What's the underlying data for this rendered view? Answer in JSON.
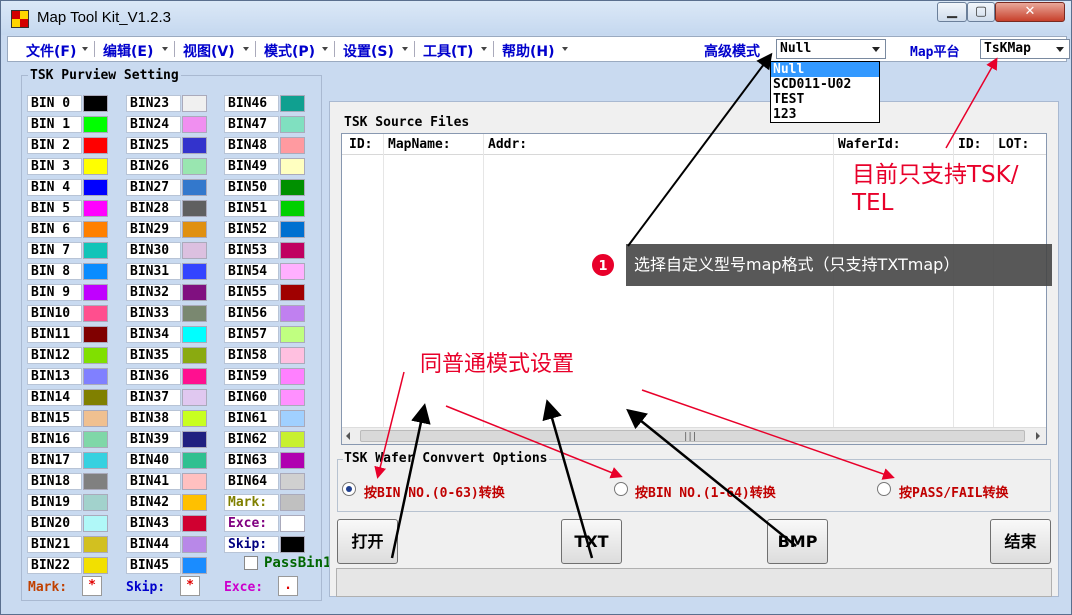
{
  "window": {
    "title": "Map Tool Kit_V1.2.3"
  },
  "menu": [
    {
      "label": "文件(F)"
    },
    {
      "label": "编辑(E)"
    },
    {
      "label": "视图(V)"
    },
    {
      "label": "模式(P)"
    },
    {
      "label": "设置(S)"
    },
    {
      "label": "工具(T)"
    },
    {
      "label": "帮助(H)"
    }
  ],
  "toolbar": {
    "advanced_label": "高级模式",
    "advanced_value": "Null",
    "advanced_options": [
      "Null",
      "SCD011-U02",
      "TEST",
      "123"
    ],
    "map_platform_label": "Map平台",
    "map_platform_value": "TsKMap"
  },
  "left_panel": {
    "title": "TSK Purview Setting",
    "bins": [
      {
        "label": "BIN 0",
        "color": "#000000"
      },
      {
        "label": "BIN 1",
        "color": "#00ff00"
      },
      {
        "label": "BIN 2",
        "color": "#ff0000"
      },
      {
        "label": "BIN 3",
        "color": "#ffff00"
      },
      {
        "label": "BIN 4",
        "color": "#0000ff"
      },
      {
        "label": "BIN 5",
        "color": "#ff00ff"
      },
      {
        "label": "BIN 6",
        "color": "#ff8000"
      },
      {
        "label": "BIN 7",
        "color": "#11c4b8"
      },
      {
        "label": "BIN 8",
        "color": "#0a8cff"
      },
      {
        "label": "BIN 9",
        "color": "#c000ff"
      },
      {
        "label": "BIN10",
        "color": "#ff4f8e"
      },
      {
        "label": "BIN11",
        "color": "#800000"
      },
      {
        "label": "BIN12",
        "color": "#80e000"
      },
      {
        "label": "BIN13",
        "color": "#8080ff"
      },
      {
        "label": "BIN14",
        "color": "#808000"
      },
      {
        "label": "BIN15",
        "color": "#f0c090"
      },
      {
        "label": "BIN16",
        "color": "#7fd7a8"
      },
      {
        "label": "BIN17",
        "color": "#36d1e0"
      },
      {
        "label": "BIN18",
        "color": "#808080"
      },
      {
        "label": "BIN19",
        "color": "#a2d2cc"
      },
      {
        "label": "BIN20",
        "color": "#b0f8f8"
      },
      {
        "label": "BIN21",
        "color": "#d2c020"
      },
      {
        "label": "BIN22",
        "color": "#f2e000"
      },
      {
        "label": "BIN23",
        "color": "#f0f0f0"
      },
      {
        "label": "BIN24",
        "color": "#f08ff0"
      },
      {
        "label": "BIN25",
        "color": "#3333cc"
      },
      {
        "label": "BIN26",
        "color": "#99e6b0"
      },
      {
        "label": "BIN27",
        "color": "#3378cc"
      },
      {
        "label": "BIN28",
        "color": "#606060"
      },
      {
        "label": "BIN29",
        "color": "#e09010"
      },
      {
        "label": "BIN30",
        "color": "#dcc0e0"
      },
      {
        "label": "BIN31",
        "color": "#3344ff"
      },
      {
        "label": "BIN32",
        "color": "#801080"
      },
      {
        "label": "BIN33",
        "color": "#7a8870"
      },
      {
        "label": "BIN34",
        "color": "#00ffff"
      },
      {
        "label": "BIN35",
        "color": "#8aaa10"
      },
      {
        "label": "BIN36",
        "color": "#ff1090"
      },
      {
        "label": "BIN37",
        "color": "#e0c8f0"
      },
      {
        "label": "BIN38",
        "color": "#c8ff20"
      },
      {
        "label": "BIN39",
        "color": "#202080"
      },
      {
        "label": "BIN40",
        "color": "#30c090"
      },
      {
        "label": "BIN41",
        "color": "#ffc0c0"
      },
      {
        "label": "BIN42",
        "color": "#ffc000"
      },
      {
        "label": "BIN43",
        "color": "#d00030"
      },
      {
        "label": "BIN44",
        "color": "#b888e8"
      },
      {
        "label": "BIN45",
        "color": "#1a8cff"
      },
      {
        "label": "BIN46",
        "color": "#10a090"
      },
      {
        "label": "BIN47",
        "color": "#80e0c0"
      },
      {
        "label": "BIN48",
        "color": "#ff9aa0"
      },
      {
        "label": "BIN49",
        "color": "#ffffc0"
      },
      {
        "label": "BIN50",
        "color": "#009000"
      },
      {
        "label": "BIN51",
        "color": "#00d000"
      },
      {
        "label": "BIN52",
        "color": "#0070d0"
      },
      {
        "label": "BIN53",
        "color": "#c00060"
      },
      {
        "label": "BIN54",
        "color": "#ffb0ff"
      },
      {
        "label": "BIN55",
        "color": "#a00000"
      },
      {
        "label": "BIN56",
        "color": "#c080f0"
      },
      {
        "label": "BIN57",
        "color": "#c0ff80"
      },
      {
        "label": "BIN58",
        "color": "#ffc0e0"
      },
      {
        "label": "BIN59",
        "color": "#ff80ff"
      },
      {
        "label": "BIN60",
        "color": "#ff90ff"
      },
      {
        "label": "BIN61",
        "color": "#a0d0ff"
      },
      {
        "label": "BIN62",
        "color": "#c8f030"
      },
      {
        "label": "BIN63",
        "color": "#b000b0"
      },
      {
        "label": "BIN64",
        "color": "#d0d0d0"
      }
    ],
    "specials": [
      {
        "label": "Mark:",
        "color": "#c0c0c0",
        "text_color": "#808000"
      },
      {
        "label": "Exce:",
        "color": "#ffffff",
        "text_color": "#800080"
      },
      {
        "label": "Skip:",
        "color": "#000000",
        "text_color": "#000080"
      }
    ],
    "passbin_label": "PassBin1",
    "bottom": [
      {
        "label": "Mark:",
        "value": "*",
        "color": "#c04000"
      },
      {
        "label": "Skip:",
        "value": "*",
        "color": "#0000cc"
      },
      {
        "label": "Exce:",
        "value": ".",
        "color": "#cc00cc"
      }
    ]
  },
  "source_files": {
    "title": "TSK Source Files",
    "columns": [
      "ID:",
      "MapName:",
      "Addr:",
      "WaferId:",
      "ID:",
      "LOT:"
    ],
    "scroll_grip": "|||"
  },
  "convert": {
    "title": "TSK Wafer Convvert Options",
    "options": [
      {
        "label": "按BIN NO.(0-63)转换",
        "selected": true
      },
      {
        "label": "按BIN NO.(1-64)转换",
        "selected": false
      },
      {
        "label": "按PASS/FAIL转换",
        "selected": false
      }
    ]
  },
  "buttons": {
    "open": "打开",
    "txt": "TXT",
    "bmp": "BMP",
    "end": "结束"
  },
  "annotations": {
    "tel_line1": "目前只支持TSK/",
    "tel_line2": "TEL",
    "callout_number": "1",
    "callout_text": "选择自定义型号map格式（只支持TXTmap）",
    "same_setting": "同普通模式设置"
  }
}
